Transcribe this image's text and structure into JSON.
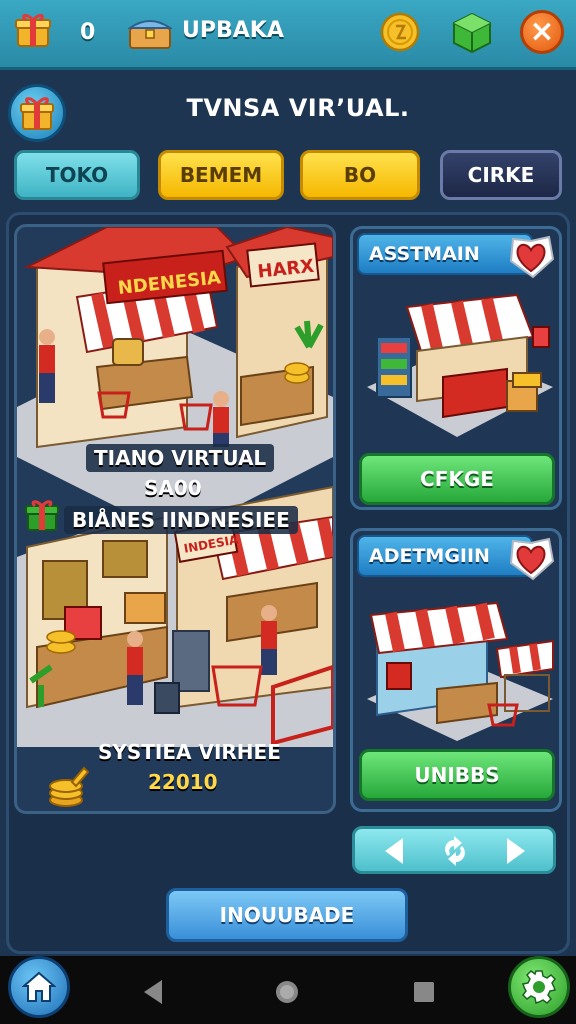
{
  "top_bar": {
    "count": "0",
    "name": "UPBAKA"
  },
  "header": {
    "title": "TVNSA VIRʼUAL."
  },
  "tabs": [
    {
      "label": "TOKO"
    },
    {
      "label": "BEMEM"
    },
    {
      "label": "BO"
    },
    {
      "label": "CIRKE"
    }
  ],
  "main_card": {
    "sign_store_1": "NDENESIA",
    "sign_store_2": "HARX",
    "sign_store_3": "INDESIA",
    "label_line_1": "TIANO VIRTUAL",
    "label_line_2": "SA00",
    "label_line_3": "BIÅNES IINDNESIEE",
    "label_line_4": "SYSTIEA VIRHEE",
    "label_line_5": "22010"
  },
  "side_cards": [
    {
      "title": "ASSTMAIN",
      "button": "CFKGE"
    },
    {
      "title": "ADETMGIIN",
      "button": "UNIBBS"
    }
  ],
  "update_button": "INOUUBADE",
  "colors": {
    "accent_teal": "#3aa8c4",
    "accent_yellow": "#f5b800",
    "accent_green": "#27a83a",
    "accent_blue": "#3a8fd8",
    "heart_red": "#e23a3a"
  },
  "icons": [
    "gift-icon",
    "chest-icon",
    "coin-icon",
    "green-cube-icon",
    "close-icon",
    "heart-icon",
    "coins-stack-icon",
    "home-icon",
    "gear-icon",
    "chevron-left-icon",
    "refresh-icon",
    "chevron-right-icon"
  ]
}
